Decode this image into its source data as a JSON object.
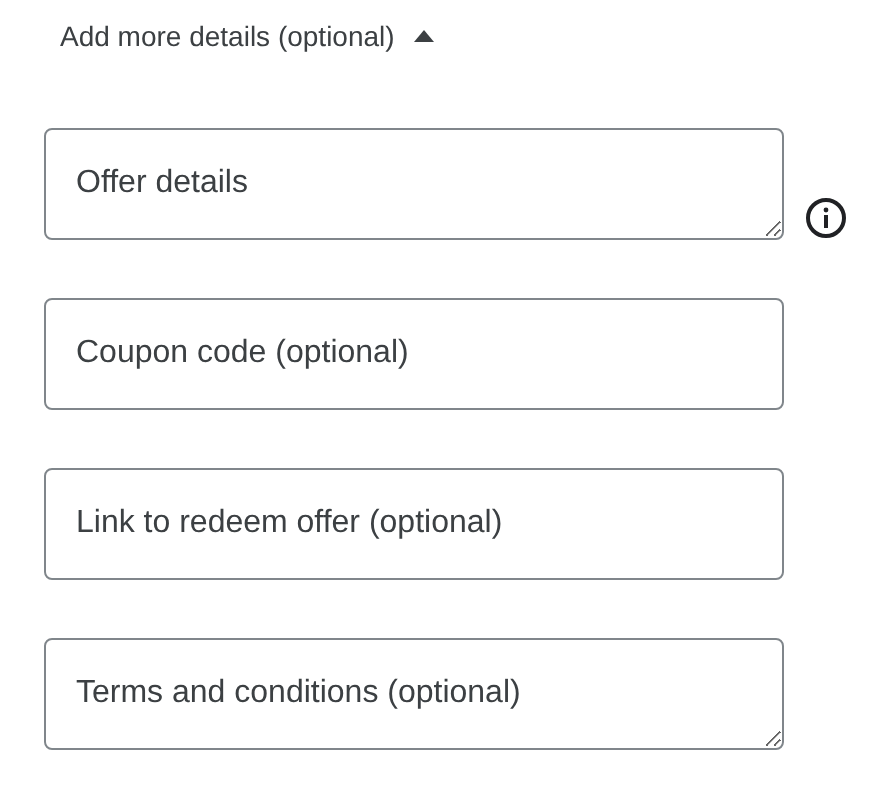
{
  "section": {
    "label": "Add more details (optional)",
    "expanded": true
  },
  "fields": [
    {
      "kind": "textarea",
      "placeholder": "Offer details",
      "info": true
    },
    {
      "kind": "input",
      "placeholder": "Coupon code (optional)",
      "info": false
    },
    {
      "kind": "input",
      "placeholder": "Link to redeem offer (optional)",
      "info": false
    },
    {
      "kind": "textarea",
      "placeholder": "Terms and conditions (optional)",
      "info": false
    }
  ]
}
